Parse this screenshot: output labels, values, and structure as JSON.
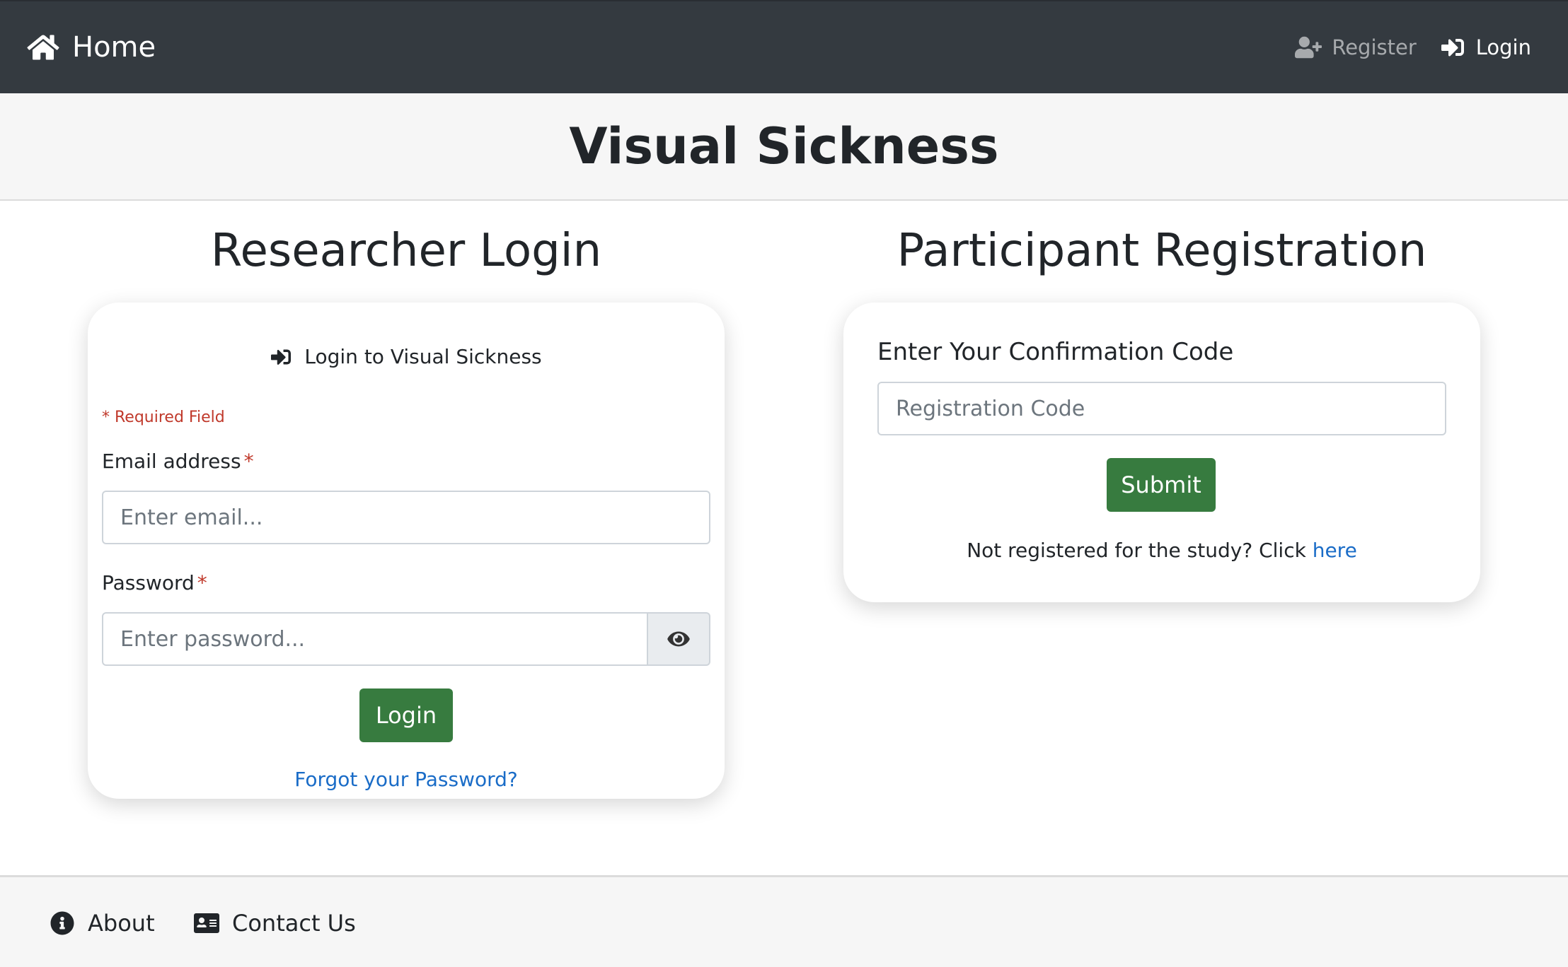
{
  "nav": {
    "brand_label": "Home",
    "brand_icon": "home-icon",
    "register_label": "Register",
    "register_icon": "user-plus-icon",
    "login_label": "Login",
    "login_icon": "sign-in-icon"
  },
  "header": {
    "title": "Visual Sickness"
  },
  "researcher": {
    "section_title": "Researcher Login",
    "card_title": "Login to Visual Sickness",
    "required_note": "* Required Field",
    "email_label": "Email address",
    "email_placeholder": "Enter email...",
    "password_label": "Password",
    "password_placeholder": "Enter password...",
    "required_marker": "*",
    "login_button": "Login",
    "forgot_link": "Forgot your Password?"
  },
  "participant": {
    "section_title": "Participant Registration",
    "code_label": "Enter Your Confirmation Code",
    "code_placeholder": "Registration Code",
    "submit_button": "Submit",
    "not_registered_text": "Not registered for the study? Click",
    "here_link": "here"
  },
  "footer": {
    "about_label": "About",
    "about_icon": "info-circle-icon",
    "contact_label": "Contact Us",
    "contact_icon": "id-card-icon"
  },
  "colors": {
    "navbar_bg": "#343a40",
    "primary_green": "#377b3f",
    "link_blue": "#1a6cc7",
    "required_red": "#c0392b"
  }
}
